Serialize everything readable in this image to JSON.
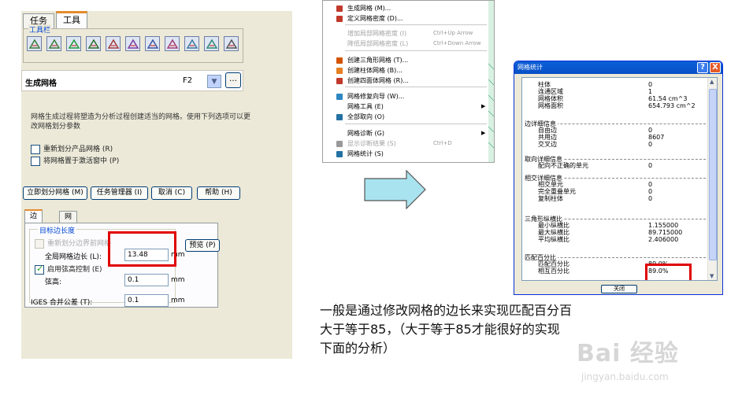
{
  "left": {
    "tabs": [
      "任务",
      "工具"
    ],
    "toolbar_caption": "工具栏",
    "toolbar_icons": [
      "mesh-surface-icon",
      "mesh-triangle-icon",
      "green-diamond-icon",
      "stack-arrow-icon",
      "mesh-split-icon",
      "mesh-refine-icon",
      "mesh-coarsen-icon",
      "mesh-distribute-icon",
      "mesh-check-icon",
      "mesh-orient-icon",
      "print-icon"
    ],
    "module_title": "生成网格",
    "module_key": "F2",
    "more_label": "…",
    "description": "网格生成过程将塑造为分析过程创建适当的网格。使用下列选项可以更改网格划分参数",
    "options": [
      {
        "label": "重新划分产品网格 (R)",
        "checked": false
      },
      {
        "label": "将网格置于激活窗中 (P)",
        "checked": false
      }
    ],
    "buttons": [
      "立即划分网格 (M)",
      "任务管理器 (I)",
      "取消 (C)",
      "帮助 (H)"
    ],
    "sub_tabs": [
      "边长",
      "网格控制"
    ],
    "group_title": "目标边长度",
    "remesh_label": "重新划分边界前网格",
    "global_edge_label": "全局网格边长 (L):",
    "global_edge_value": "13.48",
    "unit": "mm",
    "preview_label": "预览 (P)",
    "enable_chord_label": "启用弦高控制 (E)",
    "enable_chord_checked": true,
    "chord_label": "弦高:",
    "chord_value": "0.1",
    "iges_label": "IGES 合并公差 (T):",
    "iges_value": "0.1"
  },
  "menu": {
    "items": [
      {
        "label": "生成网格 (M)...",
        "shortcut": "",
        "arrow": false,
        "disabled": false,
        "icon": "mesh-generate-icon"
      },
      {
        "label": "定义网格密度 (D)...",
        "shortcut": "",
        "arrow": false,
        "disabled": false,
        "icon": "mesh-density-icon"
      },
      {
        "label": "增加局部网格密度 (I)",
        "shortcut": "Ctrl+Up Arrow",
        "arrow": false,
        "disabled": true,
        "icon": ""
      },
      {
        "label": "降低局部网格密度 (L)",
        "shortcut": "Ctrl+Down Arrow",
        "arrow": false,
        "disabled": true,
        "icon": ""
      },
      {
        "label": "创建三角形网格 (T)...",
        "shortcut": "",
        "arrow": false,
        "disabled": false,
        "icon": "triangle-mesh-icon"
      },
      {
        "label": "创建柱体网格 (B)...",
        "shortcut": "",
        "arrow": false,
        "disabled": false,
        "icon": "cylinder-mesh-icon"
      },
      {
        "label": "创建四面体网格 (R)...",
        "shortcut": "",
        "arrow": false,
        "disabled": false,
        "icon": "tetra-mesh-icon"
      },
      {
        "label": "网格修复向导 (W)...",
        "shortcut": "",
        "arrow": false,
        "disabled": false,
        "icon": "repair-wizard-icon"
      },
      {
        "label": "网格工具 (E)",
        "shortcut": "",
        "arrow": true,
        "disabled": false,
        "icon": ""
      },
      {
        "label": "全部取向 (O)",
        "shortcut": "",
        "arrow": false,
        "disabled": false,
        "icon": "orient-icon"
      },
      {
        "label": "网格诊断 (G)",
        "shortcut": "",
        "arrow": true,
        "disabled": false,
        "icon": ""
      },
      {
        "label": "显示诊断结果 (S)",
        "shortcut": "Ctrl+D",
        "arrow": false,
        "disabled": true,
        "icon": "diagnostics-icon"
      },
      {
        "label": "网格统计 (S)",
        "shortcut": "",
        "arrow": false,
        "disabled": false,
        "icon": "statistics-icon"
      }
    ]
  },
  "dialog": {
    "title": "网格统计",
    "help": "?",
    "close": "X",
    "sections": [
      {
        "name": "",
        "rows": [
          [
            "柱体",
            "0"
          ],
          [
            "连通区域",
            "1"
          ],
          [
            "网格体积",
            "61.54 cm^3"
          ],
          [
            "网格面积",
            "654.793 cm^2"
          ]
        ]
      },
      {
        "name": "边详细信息",
        "rows": [
          [
            "自由边",
            "0"
          ],
          [
            "共用边",
            "8607"
          ],
          [
            "交叉边",
            "0"
          ]
        ]
      },
      {
        "name": "取向详细信息",
        "rows": [
          [
            "配向不正确的单元",
            "0"
          ]
        ]
      },
      {
        "name": "相交详细信息",
        "rows": [
          [
            "相交单元",
            "0"
          ],
          [
            "完全重叠单元",
            "0"
          ],
          [
            "复制柱体",
            "0"
          ]
        ]
      },
      {
        "name": "三角形纵横比",
        "rows": [
          [
            "最小纵横比",
            "1.155000"
          ],
          [
            "最大纵横比",
            "89.715000"
          ],
          [
            "平均纵横比",
            "2.406000"
          ]
        ]
      },
      {
        "name": "匹配百分比",
        "rows": [
          [
            "匹配百分比",
            "89.0%"
          ],
          [
            "相互百分比",
            "89.0%"
          ]
        ]
      }
    ],
    "close_button": "关闭"
  },
  "caption": "一般是通过修改网格的边长来实现匹配百分百大于等于85，（大于等于85才能很好的实现下面的分析）",
  "watermark": {
    "main": "Bai 经验",
    "sub": "jingyan.baidu.com"
  },
  "colors": {
    "highlight": "#e00000",
    "arrow_fill": "#a9e3ef",
    "title_bar": "#0a5fd8"
  }
}
